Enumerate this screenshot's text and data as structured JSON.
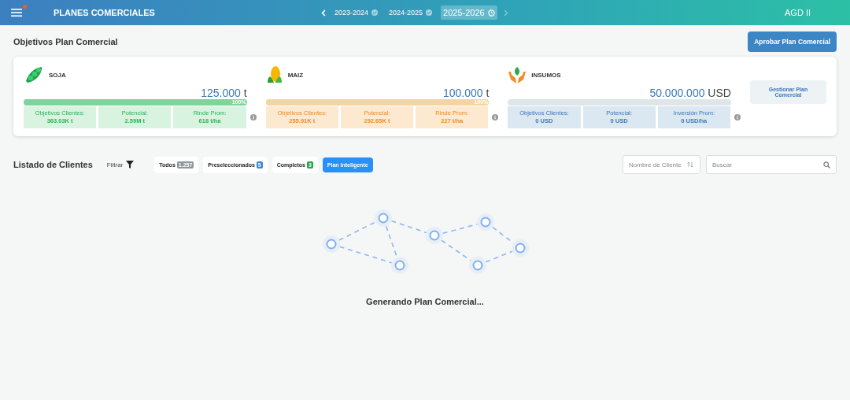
{
  "header": {
    "title": "PLANES COMERCIALES",
    "notification": true,
    "years": [
      {
        "label": "2023-2024",
        "selected": false,
        "completed": true
      },
      {
        "label": "2024-2025",
        "selected": false,
        "completed": true
      },
      {
        "label": "2025-2026",
        "selected": true,
        "completed": false
      }
    ],
    "user": "AGD II"
  },
  "objectives": {
    "title": "Objetivos Plan Comercial",
    "approve_button": "Aprobar Plan Comercial",
    "manage_button": "Gestionar Plan Comercial",
    "products": [
      {
        "kind": "soja",
        "name": "SOJA",
        "amount": "125.000",
        "unit": "t",
        "level": 1,
        "bar_label": "100%",
        "stats": [
          {
            "label": "Objetivos Clientes:",
            "value": "363.03K t"
          },
          {
            "label": "Potencial:",
            "value": "2.59M t"
          },
          {
            "label": "Rinde Prom:",
            "value": "618 t/ha"
          }
        ]
      },
      {
        "kind": "maiz",
        "name": "MAIZ",
        "amount": "100.000",
        "unit": "t",
        "level": 1,
        "bar_label": "100%",
        "stats": [
          {
            "label": "Objetivos Clientes:",
            "value": "255.91K t"
          },
          {
            "label": "Potencial:",
            "value": "292.65K t"
          },
          {
            "label": "Rinde Prom:",
            "value": "227 t/ha"
          }
        ]
      },
      {
        "kind": "insumos",
        "name": "INSUMOS",
        "amount": "50.000.000",
        "unit": "USD",
        "level": 0,
        "stats": [
          {
            "label": "Objetivos Clientes:",
            "value": "0 USD"
          },
          {
            "label": "Potencial:",
            "value": "0 USD"
          },
          {
            "label": "Inversión Prom:",
            "value": "0 USD/ha"
          }
        ]
      }
    ]
  },
  "clients": {
    "title": "Listado de Clientes",
    "filter": "Filtrar",
    "chips": [
      {
        "label": "Todos",
        "count": "1.257",
        "color": "#8f9699",
        "selected": false
      },
      {
        "label": "Preseleccionados",
        "count": "5",
        "color": "#3a86d6",
        "selected": false
      },
      {
        "label": "Completos",
        "count": "3",
        "color": "#1fa843",
        "selected": false
      },
      {
        "label": "Plan Inteligente",
        "selected": true
      }
    ],
    "sort_field": {
      "placeholder": "Nombre de Cliente"
    },
    "search": {
      "placeholder": "Buscar"
    }
  },
  "loading": {
    "message": "Generando Plan Comercial..."
  }
}
